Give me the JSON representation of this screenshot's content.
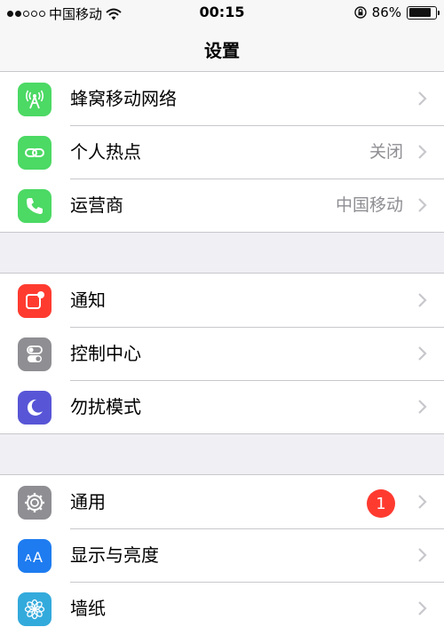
{
  "status_bar": {
    "carrier": "中国移动",
    "time": "00:15",
    "battery_text": "86%",
    "battery_level": 0.86,
    "signal_bars_filled": 2,
    "signal_bars_total": 5
  },
  "nav": {
    "title": "设置"
  },
  "groups": [
    {
      "rows": [
        {
          "label": "蜂窝移动网络",
          "icon": "cellular-antenna-icon",
          "icon_color": "#4cd964"
        },
        {
          "label": "个人热点",
          "detail": "关闭",
          "icon": "hotspot-chain-icon",
          "icon_color": "#4cd964"
        },
        {
          "label": "运营商",
          "detail": "中国移动",
          "icon": "phone-icon",
          "icon_color": "#4cd964"
        }
      ]
    },
    {
      "rows": [
        {
          "label": "通知",
          "icon": "notifications-icon",
          "icon_color": "#ff3b30"
        },
        {
          "label": "控制中心",
          "icon": "toggles-icon",
          "icon_color": "#8e8e93"
        },
        {
          "label": "勿扰模式",
          "icon": "moon-icon",
          "icon_color": "#5856d6"
        }
      ]
    },
    {
      "rows": [
        {
          "label": "通用",
          "badge": "1",
          "icon": "gear-icon",
          "icon_color": "#8e8e93"
        },
        {
          "label": "显示与亮度",
          "icon": "text-size-icon",
          "icon_color": "#1e7cf0"
        },
        {
          "label": "墙纸",
          "icon": "flower-icon",
          "icon_color": "#33aadc"
        }
      ]
    }
  ]
}
